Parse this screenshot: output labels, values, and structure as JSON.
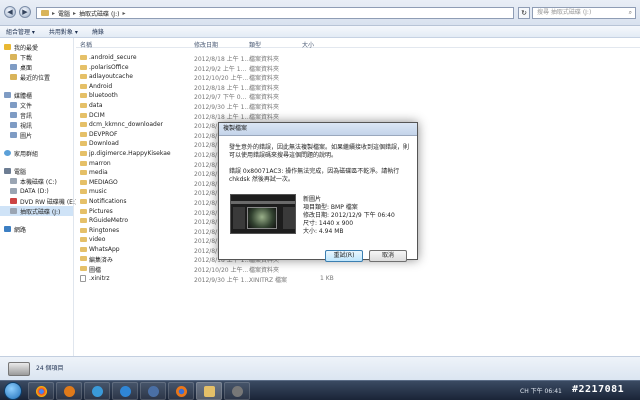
{
  "address_bar": {
    "breadcrumb": [
      "電腦",
      "抽取式磁碟 (J:)"
    ],
    "search_placeholder": "搜尋 抽取式磁碟 (J:)"
  },
  "toolbar": {
    "organize": "組合管理 ▾",
    "share": "共用對象 ▾",
    "burn": "燒錄"
  },
  "sidebar": {
    "favorites": {
      "header": "我的最愛",
      "items": [
        "下載",
        "桌面",
        "最近的位置"
      ]
    },
    "libraries": {
      "header": "媒體櫃",
      "items": [
        "文件",
        "音訊",
        "視訊",
        "圖片"
      ]
    },
    "homegroup": {
      "header": "家用群組"
    },
    "computer": {
      "header": "電腦",
      "items": [
        "本機磁碟 (C:)",
        "DATA (D:)",
        "DVD RW 磁碟機 (E:)",
        "抽取式磁碟 (J:)"
      ]
    },
    "network": {
      "header": "網路"
    }
  },
  "columns": {
    "name": "名稱",
    "date": "修改日期",
    "type": "類型",
    "size": "大小"
  },
  "files": [
    {
      "name": ".android_secure",
      "date": "2012/8/18 上午 1...",
      "type": "檔案資料夾",
      "size": "",
      "folder": true
    },
    {
      "name": ".polarisOffice",
      "date": "2012/9/2 上午 1...",
      "type": "檔案資料夾",
      "size": "",
      "folder": true
    },
    {
      "name": "adlayoutcache",
      "date": "2012/10/20 上午...",
      "type": "檔案資料夾",
      "size": "",
      "folder": true
    },
    {
      "name": "Android",
      "date": "2012/8/18 上午 1...",
      "type": "檔案資料夾",
      "size": "",
      "folder": true
    },
    {
      "name": "bluetooth",
      "date": "2012/9/7 下午 0...",
      "type": "檔案資料夾",
      "size": "",
      "folder": true
    },
    {
      "name": "data",
      "date": "2012/9/30 上午 1...",
      "type": "檔案資料夾",
      "size": "",
      "folder": true
    },
    {
      "name": "DCIM",
      "date": "2012/8/18 上午 1...",
      "type": "檔案資料夾",
      "size": "",
      "folder": true
    },
    {
      "name": "dcm_kkmnc_downloader",
      "date": "2012/8/18 上午 1...",
      "type": "檔案資料夾",
      "size": "",
      "folder": true
    },
    {
      "name": "DEVPROF",
      "date": "2012/8/18 上午 1...",
      "type": "檔案資料夾",
      "size": "",
      "folder": true
    },
    {
      "name": "Download",
      "date": "2012/8/18 上午 1...",
      "type": "檔案資料夾",
      "size": "",
      "folder": true
    },
    {
      "name": "jp.digimerce.HappyKisekae",
      "date": "2012/8/18 上午 1...",
      "type": "檔案資料夾",
      "size": "",
      "folder": true
    },
    {
      "name": "marron",
      "date": "2012/8/18 上午 1...",
      "type": "檔案資料夾",
      "size": "",
      "folder": true
    },
    {
      "name": "media",
      "date": "2012/8/18 上午 1...",
      "type": "檔案資料夾",
      "size": "",
      "folder": true
    },
    {
      "name": "MEDIAGO",
      "date": "2012/8/18 上午 1...",
      "type": "檔案資料夾",
      "size": "",
      "folder": true
    },
    {
      "name": "music",
      "date": "2012/8/18 上午 1...",
      "type": "檔案資料夾",
      "size": "",
      "folder": true
    },
    {
      "name": "Notifications",
      "date": "2012/8/18 上午 1...",
      "type": "檔案資料夾",
      "size": "",
      "folder": true
    },
    {
      "name": "Pictures",
      "date": "2012/8/18 上午 1...",
      "type": "檔案資料夾",
      "size": "",
      "folder": true
    },
    {
      "name": "RGuideMetro",
      "date": "2012/8/18 上午 1...",
      "type": "檔案資料夾",
      "size": "",
      "folder": true
    },
    {
      "name": "Ringtones",
      "date": "2012/8/18 上午 1...",
      "type": "檔案資料夾",
      "size": "",
      "folder": true
    },
    {
      "name": "video",
      "date": "2012/8/18 上午 1...",
      "type": "檔案資料夾",
      "size": "",
      "folder": true
    },
    {
      "name": "WhatsApp",
      "date": "2012/8/18 上午 1...",
      "type": "檔案資料夾",
      "size": "",
      "folder": true
    },
    {
      "name": "編集済み",
      "date": "2012/8/18 上午 1...",
      "type": "檔案資料夾",
      "size": "",
      "folder": true
    },
    {
      "name": "圖檔",
      "date": "2012/10/20 上午...",
      "type": "檔案資料夾",
      "size": "",
      "folder": true
    },
    {
      "name": ".xinitrz",
      "date": "2012/9/30 上午 1...",
      "type": "XINITRZ 檔案",
      "size": "1 KB",
      "folder": false
    }
  ],
  "status": {
    "count": "24 個項目"
  },
  "dialog": {
    "title": "複製檔案",
    "message": "發生意外的錯誤，因此無法複製檔案。如果繼續接收到這個錯誤，則可以使用錯誤碼來搜尋這個問題的說明。",
    "error": "錯誤 0x80071AC3: 操作無法完成，因為磁碟區不乾淨。請執行 chkdsk 然後再試一次。",
    "file_name": "新圖片",
    "file_type": "項目類型: BMP 檔案",
    "file_modified": "修改日期: 2012/12/9 下午 06:40",
    "file_dimensions": "尺寸: 1440 x 900",
    "file_size": "大小: 4.94 MB",
    "retry": "重試(R)",
    "cancel": "取消"
  },
  "tray": {
    "lang": "CH",
    "clock": "下午 06:41"
  },
  "watermark": "#2217081"
}
